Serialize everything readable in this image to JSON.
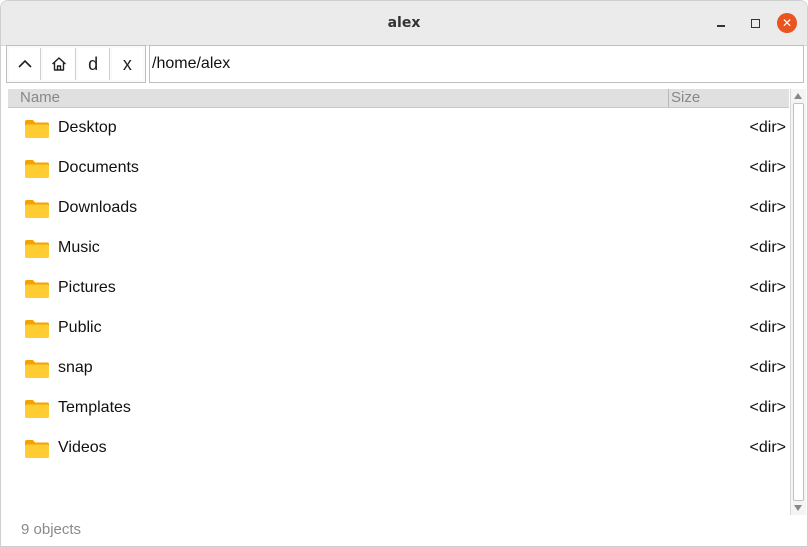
{
  "window": {
    "title": "alex",
    "close_glyph": "✕"
  },
  "toolbar": {
    "up_icon": "chevron-up-icon",
    "home_icon": "home-icon",
    "d_label": "d",
    "x_label": "x",
    "path": "/home/alex"
  },
  "columns": {
    "name": "Name",
    "size": "Size"
  },
  "files": [
    {
      "name": "Desktop",
      "size": "<dir>",
      "icon": "folder-icon"
    },
    {
      "name": "Documents",
      "size": "<dir>",
      "icon": "folder-icon"
    },
    {
      "name": "Downloads",
      "size": "<dir>",
      "icon": "folder-icon"
    },
    {
      "name": "Music",
      "size": "<dir>",
      "icon": "folder-icon"
    },
    {
      "name": "Pictures",
      "size": "<dir>",
      "icon": "folder-icon"
    },
    {
      "name": "Public",
      "size": "<dir>",
      "icon": "folder-icon"
    },
    {
      "name": "snap",
      "size": "<dir>",
      "icon": "folder-icon"
    },
    {
      "name": "Templates",
      "size": "<dir>",
      "icon": "folder-icon"
    },
    {
      "name": "Videos",
      "size": "<dir>",
      "icon": "folder-icon"
    }
  ],
  "status": {
    "text": "9 objects"
  },
  "colors": {
    "close_button": "#e95420",
    "folder_front": "#ffcc33",
    "folder_back": "#f5a300",
    "header_bg": "#e0e0e0"
  }
}
